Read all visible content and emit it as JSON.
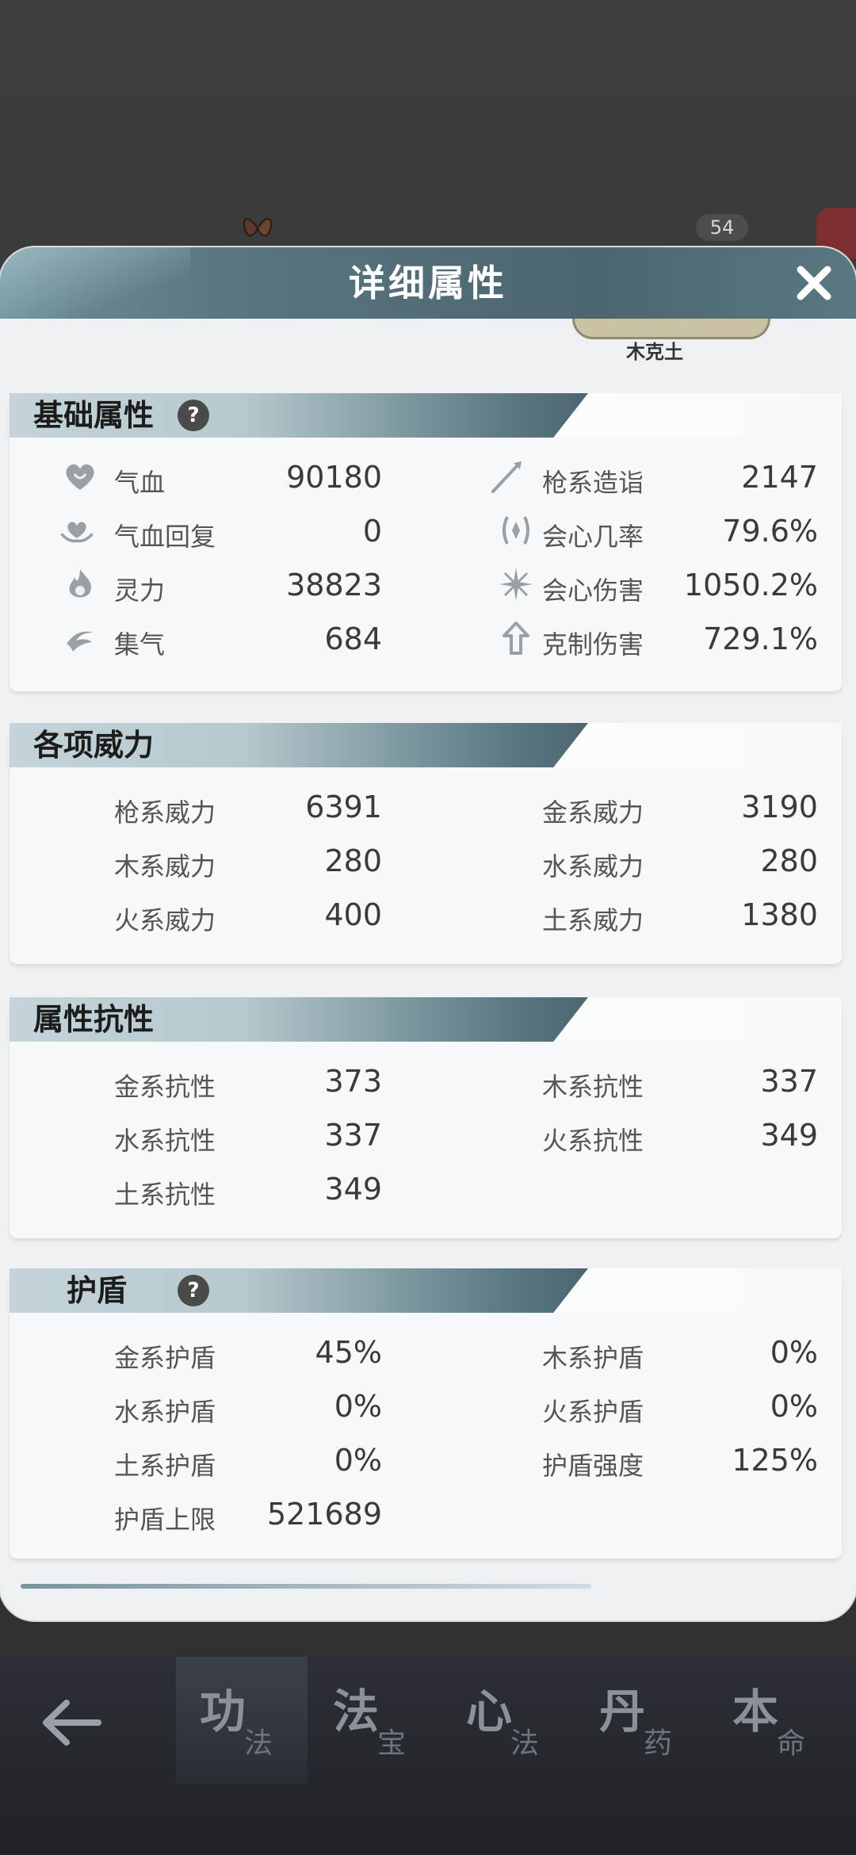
{
  "panel": {
    "title": "详细属性",
    "emblem_label": "木克土"
  },
  "background": {
    "badge": "54",
    "strip_text": "",
    "nav": [
      {
        "big": "功",
        "small": "法"
      },
      {
        "big": "法",
        "small": "宝"
      },
      {
        "big": "心",
        "small": "法"
      },
      {
        "big": "丹",
        "small": "药"
      },
      {
        "big": "本",
        "small": "命"
      }
    ]
  },
  "basic": {
    "title": "基础属性",
    "help": "?",
    "left": [
      {
        "icon": "heart-icon",
        "label": "气血",
        "value": "90180"
      },
      {
        "icon": "heal-icon",
        "label": "气血回复",
        "value": "0"
      },
      {
        "icon": "flame-icon",
        "label": "灵力",
        "value": "38823"
      },
      {
        "icon": "swirl-icon",
        "label": "集气",
        "value": "684"
      }
    ],
    "right": [
      {
        "icon": "spear-icon",
        "label": "枪系造诣",
        "value": "2147"
      },
      {
        "icon": "crit-rate-icon",
        "label": "会心几率",
        "value": "79.6%"
      },
      {
        "icon": "crit-burst-icon",
        "label": "会心伤害",
        "value": "1050.2%"
      },
      {
        "icon": "counter-arrow-icon",
        "label": "克制伤害",
        "value": "729.1%"
      }
    ]
  },
  "power": {
    "title": "各项威力",
    "left": [
      {
        "label": "枪系威力",
        "value": "6391"
      },
      {
        "label": "木系威力",
        "value": "280"
      },
      {
        "label": "火系威力",
        "value": "400"
      }
    ],
    "right": [
      {
        "label": "金系威力",
        "value": "3190"
      },
      {
        "label": "水系威力",
        "value": "280"
      },
      {
        "label": "土系威力",
        "value": "1380"
      }
    ]
  },
  "resist": {
    "title": "属性抗性",
    "left": [
      {
        "label": "金系抗性",
        "value": "373"
      },
      {
        "label": "水系抗性",
        "value": "337"
      },
      {
        "label": "土系抗性",
        "value": "349"
      }
    ],
    "right": [
      {
        "label": "木系抗性",
        "value": "337"
      },
      {
        "label": "火系抗性",
        "value": "349"
      }
    ]
  },
  "shield": {
    "title": "护盾",
    "help": "?",
    "left": [
      {
        "label": "金系护盾",
        "value": "45%"
      },
      {
        "label": "水系护盾",
        "value": "0%"
      },
      {
        "label": "土系护盾",
        "value": "0%"
      },
      {
        "label": "护盾上限",
        "value": "521689"
      }
    ],
    "right": [
      {
        "label": "木系护盾",
        "value": "0%"
      },
      {
        "label": "火系护盾",
        "value": "0%"
      },
      {
        "label": "护盾强度",
        "value": "125%"
      }
    ]
  },
  "colors": {
    "header": "#58747e",
    "panel_bg": "#eef1f3",
    "nav_bg": "#23272c"
  }
}
